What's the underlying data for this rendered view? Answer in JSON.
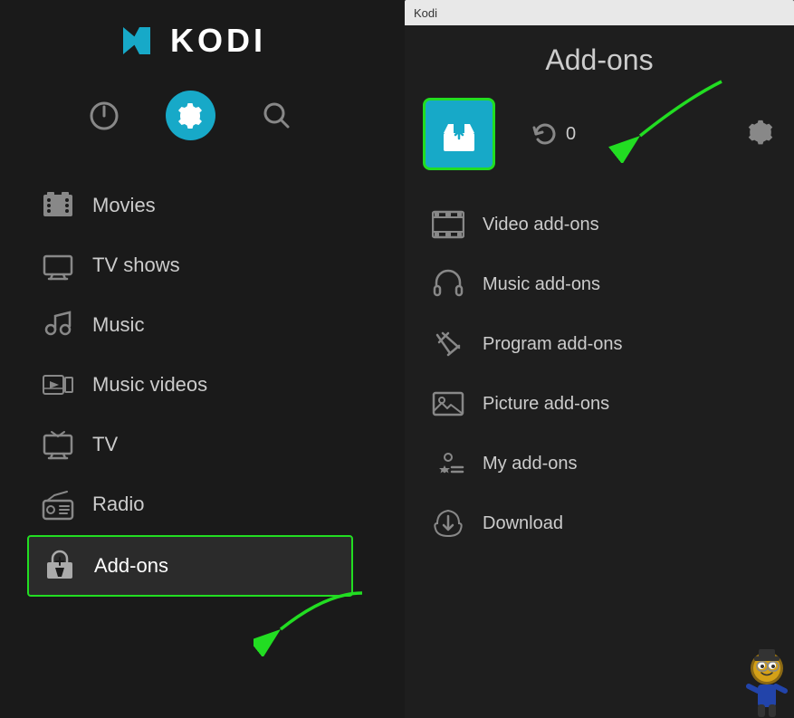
{
  "app": {
    "title": "Kodi",
    "window_title": "Kodi"
  },
  "left": {
    "logo_text": "KODI",
    "nav": {
      "power_label": "power",
      "settings_label": "settings",
      "search_label": "search"
    },
    "menu": [
      {
        "id": "movies",
        "label": "Movies",
        "icon": "movies"
      },
      {
        "id": "tvshows",
        "label": "TV shows",
        "icon": "tvshows"
      },
      {
        "id": "music",
        "label": "Music",
        "icon": "music"
      },
      {
        "id": "musicvideos",
        "label": "Music videos",
        "icon": "musicvideos"
      },
      {
        "id": "tv",
        "label": "TV",
        "icon": "tv"
      },
      {
        "id": "radio",
        "label": "Radio",
        "icon": "radio"
      },
      {
        "id": "addons",
        "label": "Add-ons",
        "icon": "addons",
        "active": true
      }
    ]
  },
  "right": {
    "title": "Add-ons",
    "toolbar": {
      "refresh_count": "0"
    },
    "items": [
      {
        "id": "video",
        "label": "Video add-ons",
        "icon": "film"
      },
      {
        "id": "music",
        "label": "Music add-ons",
        "icon": "headphones"
      },
      {
        "id": "program",
        "label": "Program add-ons",
        "icon": "wrench"
      },
      {
        "id": "picture",
        "label": "Picture add-ons",
        "icon": "picture"
      },
      {
        "id": "my",
        "label": "My add-ons",
        "icon": "gear-list"
      },
      {
        "id": "download",
        "label": "Download",
        "icon": "download"
      }
    ],
    "colors": {
      "accent": "#17a9c8",
      "highlight": "#22dd22"
    }
  }
}
